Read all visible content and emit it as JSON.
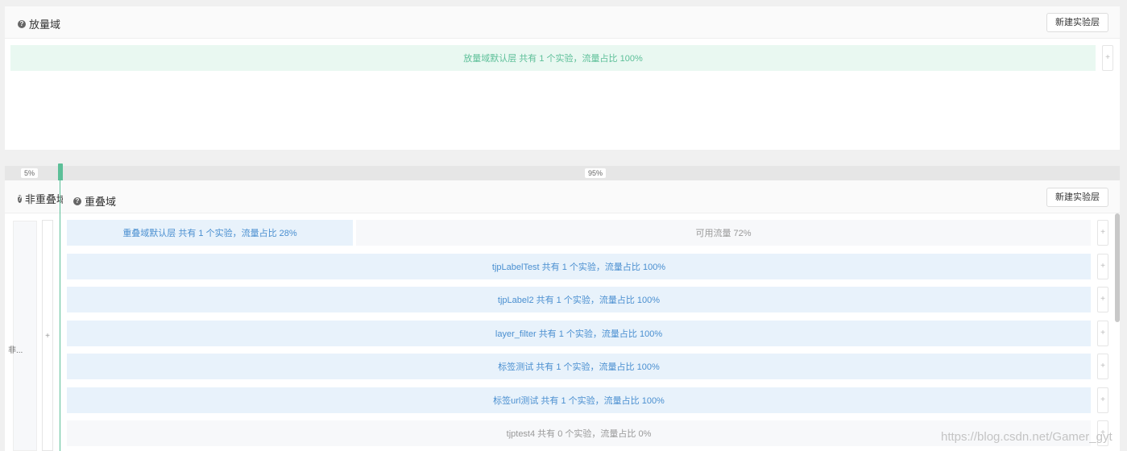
{
  "top_domain": {
    "title": "放量域",
    "new_layer_label": "新建实验层",
    "default_layer": "放量域默认层 共有 1 个实验，流量占比 100%",
    "plus": "+"
  },
  "split": {
    "left_percent": "5%",
    "right_percent": "95%"
  },
  "non_overlap": {
    "title": "非重叠域",
    "collapsed_label": "非...",
    "plus": "+"
  },
  "overlap_domain": {
    "title": "重叠域",
    "new_layer_label": "新建实验层",
    "default_layer": "重叠域默认层 共有 1 个实验，流量占比 28%",
    "available": "可用流量 72%",
    "layers": [
      "tjpLabelTest 共有 1 个实验，流量占比 100%",
      "tjpLabel2 共有 1 个实验，流量占比 100%",
      "layer_filter 共有 1 个实验，流量占比 100%",
      "标签测试 共有 1 个实验，流量占比 100%",
      "标签url测试 共有 1 个实验，流量占比 100%",
      "tjptest4 共有 0 个实验，流量占比 0%"
    ],
    "plus": "+"
  },
  "watermark": "https://blog.csdn.net/Gamer_gyt",
  "colors": {
    "green_accent": "#5cbf98",
    "green_bg": "#e9f8f1",
    "green_text": "#5cbf98",
    "blue_bg": "#e8f2fb",
    "blue_text": "#4a8fd0",
    "grey_bg": "#f7f8fa"
  }
}
